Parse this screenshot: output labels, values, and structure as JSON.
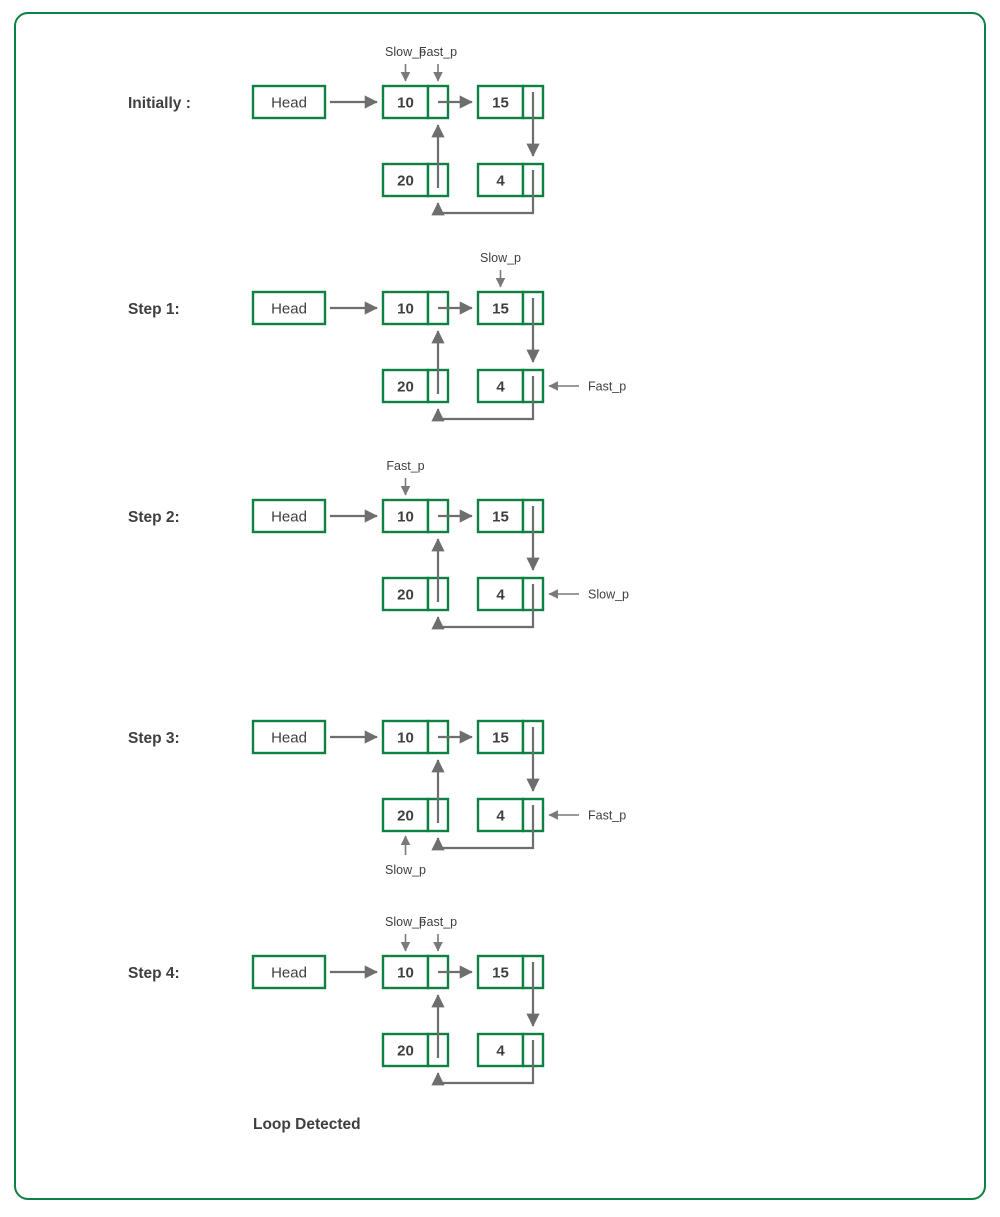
{
  "frame": {
    "border_color": "#0e8043",
    "background": "#ffffff"
  },
  "palette": {
    "node_border": "#0e8043",
    "arrow": "#6e6e6e",
    "text": "#3f3f3f"
  },
  "head_label": "Head",
  "footer": {
    "loop_detected": "Loop Detected"
  },
  "pointer_names": {
    "slow": "Slow_p",
    "fast": "Fast_p"
  },
  "nodes": {
    "top_left": "10",
    "top_right": "15",
    "bottom_left": "20",
    "bottom_right": "4"
  },
  "steps": [
    {
      "id": "initially",
      "label": "Initially :",
      "head": "Head",
      "nodes": {
        "top_left": "10",
        "top_right": "15",
        "bottom_left": "20",
        "bottom_right": "4"
      },
      "pointers": [
        {
          "name": "Slow_p",
          "target": "top_left",
          "slot": "value",
          "placement": "above"
        },
        {
          "name": "Fast_p",
          "target": "top_left",
          "slot": "pointer",
          "placement": "above"
        }
      ]
    },
    {
      "id": "step1",
      "label": "Step 1:",
      "head": "Head",
      "nodes": {
        "top_left": "10",
        "top_right": "15",
        "bottom_left": "20",
        "bottom_right": "4"
      },
      "pointers": [
        {
          "name": "Slow_p",
          "target": "top_right",
          "slot": "value",
          "placement": "above"
        },
        {
          "name": "Fast_p",
          "target": "bottom_right",
          "slot": "pointer",
          "placement": "right"
        }
      ]
    },
    {
      "id": "step2",
      "label": "Step 2:",
      "head": "Head",
      "nodes": {
        "top_left": "10",
        "top_right": "15",
        "bottom_left": "20",
        "bottom_right": "4"
      },
      "pointers": [
        {
          "name": "Fast_p",
          "target": "top_left",
          "slot": "value",
          "placement": "above"
        },
        {
          "name": "Slow_p",
          "target": "bottom_right",
          "slot": "pointer",
          "placement": "right"
        }
      ]
    },
    {
      "id": "step3",
      "label": "Step 3:",
      "head": "Head",
      "nodes": {
        "top_left": "10",
        "top_right": "15",
        "bottom_left": "20",
        "bottom_right": "4"
      },
      "pointers": [
        {
          "name": "Slow_p",
          "target": "bottom_left",
          "slot": "value",
          "placement": "below"
        },
        {
          "name": "Fast_p",
          "target": "bottom_right",
          "slot": "pointer",
          "placement": "right"
        }
      ]
    },
    {
      "id": "step4",
      "label": "Step 4:",
      "head": "Head",
      "nodes": {
        "top_left": "10",
        "top_right": "15",
        "bottom_left": "20",
        "bottom_right": "4"
      },
      "pointers": [
        {
          "name": "Slow_p",
          "target": "top_left",
          "slot": "value",
          "placement": "above"
        },
        {
          "name": "Fast_p",
          "target": "top_left",
          "slot": "pointer",
          "placement": "above"
        }
      ]
    }
  ]
}
